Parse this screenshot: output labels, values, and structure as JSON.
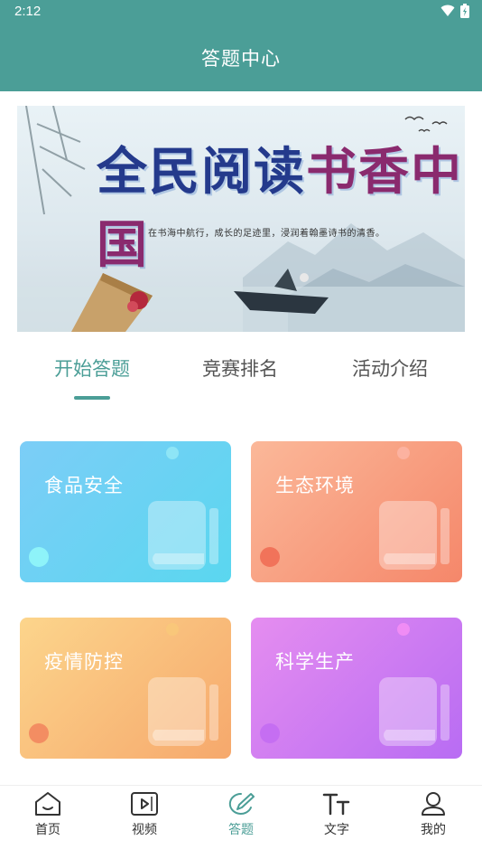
{
  "status_bar": {
    "time": "2:12"
  },
  "header": {
    "title": "答题中心"
  },
  "banner": {
    "headline_part1": "全民阅读",
    "headline_part2": "书香中国",
    "subtitle": "在书海中航行，成长的足迹里，浸润着翰墨诗书的清香。"
  },
  "tabs": [
    {
      "label": "开始答题",
      "active": true
    },
    {
      "label": "竞赛排名",
      "active": false
    },
    {
      "label": "活动介绍",
      "active": false
    }
  ],
  "categories": [
    {
      "label": "食品安全",
      "color": "#5ad7ef"
    },
    {
      "label": "生态环境",
      "color": "#f5876a"
    },
    {
      "label": "疫情防控",
      "color": "#f6a86c"
    },
    {
      "label": "科学生产",
      "color": "#b86cf3"
    }
  ],
  "bottom_nav": [
    {
      "label": "首页",
      "icon": "home-icon"
    },
    {
      "label": "视频",
      "icon": "video-icon"
    },
    {
      "label": "答题",
      "icon": "answer-edit-icon",
      "active": true
    },
    {
      "label": "文字",
      "icon": "text-icon"
    },
    {
      "label": "我的",
      "icon": "profile-icon"
    }
  ],
  "theme": {
    "primary": "#4b9e97"
  }
}
